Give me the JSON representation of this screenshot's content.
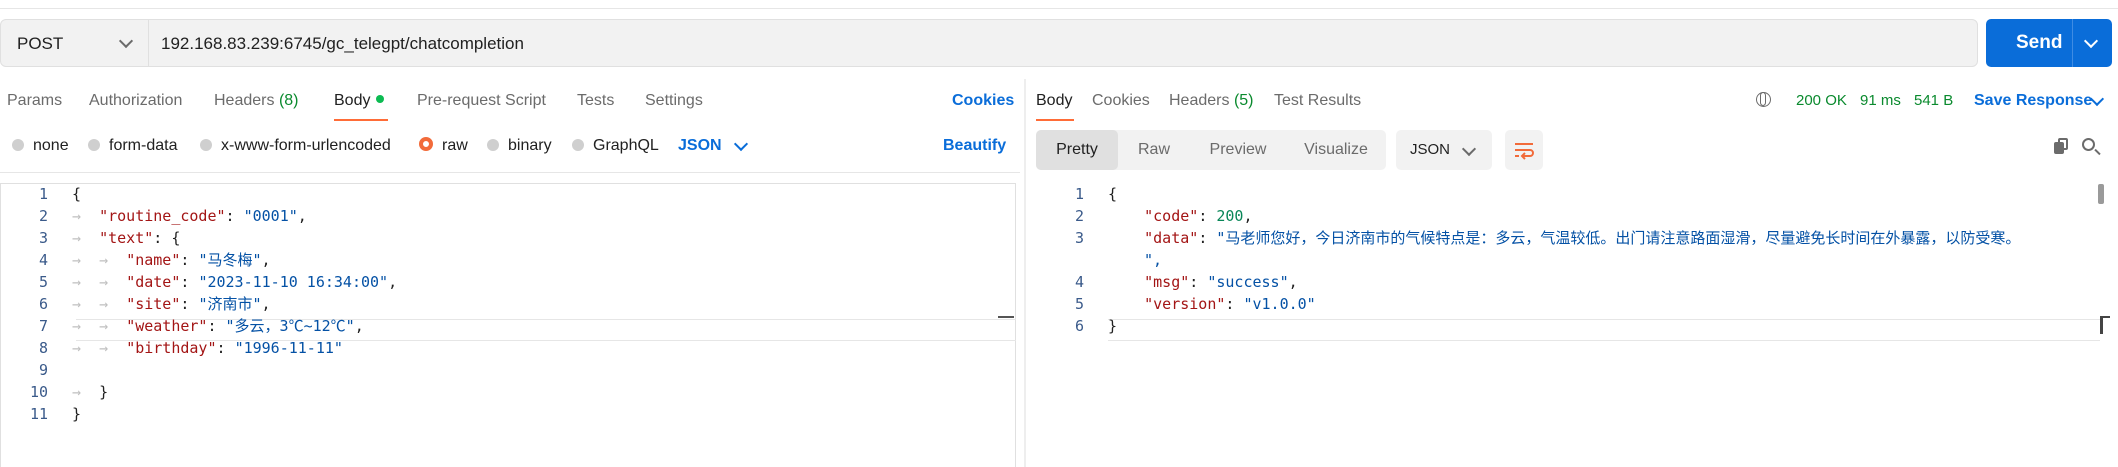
{
  "request": {
    "method": "POST",
    "url": "192.168.83.239:6745/gc_telegpt/chatcompletion",
    "send_label": "Send"
  },
  "request_tabs": [
    {
      "label": "Params"
    },
    {
      "label": "Authorization"
    },
    {
      "label": "Headers",
      "count": "(8)"
    },
    {
      "label": "Body"
    },
    {
      "label": "Pre-request Script"
    },
    {
      "label": "Tests"
    },
    {
      "label": "Settings"
    }
  ],
  "cookies_label": "Cookies",
  "body_types": [
    "none",
    "form-data",
    "x-www-form-urlencoded",
    "raw",
    "binary",
    "GraphQL"
  ],
  "body_format": "JSON",
  "beautify_label": "Beautify",
  "request_body": {
    "line_numbers": [
      "1",
      "2",
      "3",
      "4",
      "5",
      "6",
      "7",
      "8",
      "9",
      "10",
      "11"
    ],
    "keys": {
      "routine_code": "\"routine_code\"",
      "text": "\"text\"",
      "name": "\"name\"",
      "date": "\"date\"",
      "site": "\"site\"",
      "weather": "\"weather\"",
      "birthday": "\"birthday\""
    },
    "values": {
      "routine_code": "\"0001\"",
      "name": "\"马冬梅\"",
      "date": "\"2023-11-10 16:34:00\"",
      "site": "\"济南市\"",
      "weather": "\"多云，3℃~12℃\"",
      "birthday": "\"1996-11-11\""
    }
  },
  "response_tabs": [
    {
      "label": "Body"
    },
    {
      "label": "Cookies"
    },
    {
      "label": "Headers",
      "count": "(5)"
    },
    {
      "label": "Test Results"
    }
  ],
  "response_status": {
    "code": "200 OK",
    "time": "91 ms",
    "size": "541 B"
  },
  "save_response_label": "Save Response",
  "view_modes": [
    "Pretty",
    "Raw",
    "Preview",
    "Visualize"
  ],
  "response_format": "JSON",
  "response_body": {
    "line_numbers": [
      "1",
      "2",
      "3",
      "4",
      "5",
      "6"
    ],
    "keys": {
      "code": "\"code\"",
      "data": "\"data\"",
      "msg": "\"msg\"",
      "version": "\"version\""
    },
    "values": {
      "code": "200",
      "data": "\"马老师您好，今日济南市的气候特点是：多云，气温较低。出门请注意路面湿滑，尽量避免长时间在外暴露，以防受寒。",
      "data_wrap": "\",",
      "msg": "\"success\"",
      "version": "\"v1.0.0\""
    }
  },
  "icons": {
    "method_dropdown": "chevron-down-icon",
    "send_dropdown": "chevron-down-icon",
    "globe": "globe-icon",
    "wrap": "word-wrap-icon",
    "copy": "copy-icon",
    "search": "search-icon"
  },
  "colors": {
    "accent": "#ff6c37",
    "primary": "#0a6dd9",
    "status_ok": "#0a8a2e",
    "json_key": "#a31515",
    "json_string": "#0451a5",
    "json_number": "#098658"
  }
}
